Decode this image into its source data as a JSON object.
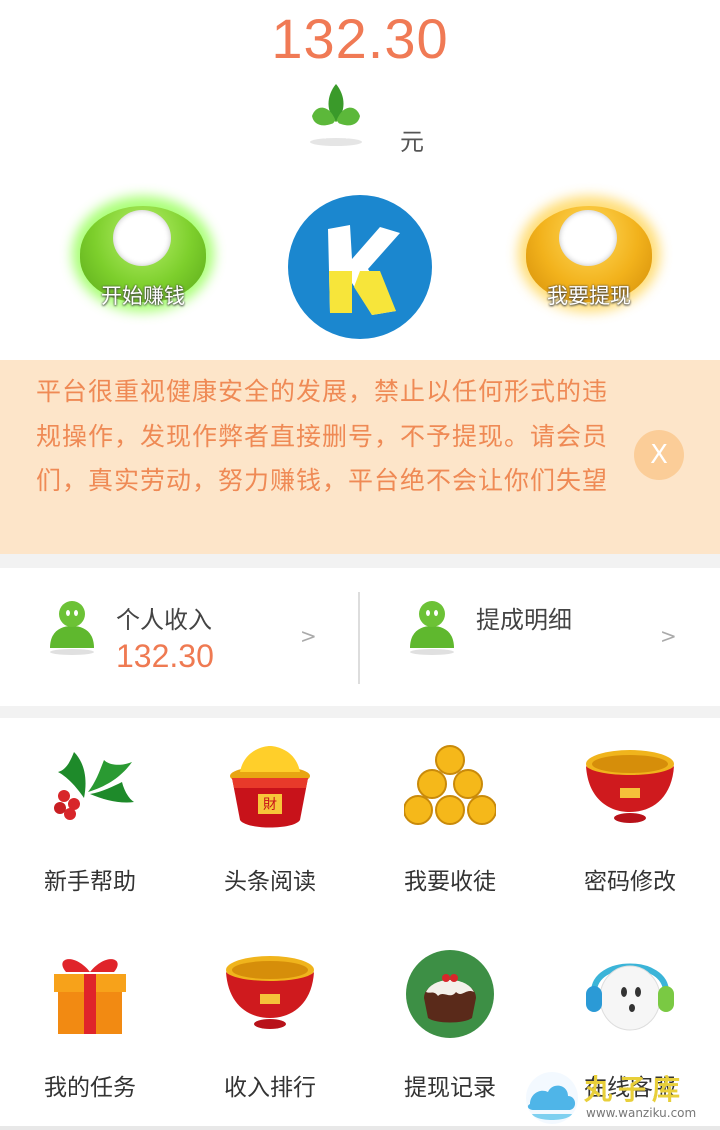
{
  "balance": {
    "amount": "132.30",
    "unit": "元"
  },
  "actions": {
    "earn_label": "开始赚钱",
    "withdraw_label": "我要提现",
    "logo_letter": "K"
  },
  "notice": {
    "text": "平台很重视健康安全的发展，禁止以任何形式的违规操作，发现作弊者直接删号，不予提现。请会员们，真实劳动，努力赚钱，平台绝不会让你们失望",
    "close_label": "X"
  },
  "stats": {
    "income_label": "个人收入",
    "income_value": "132.30",
    "commission_label": "提成明细",
    "chevron": ">"
  },
  "menu": [
    {
      "label": "新手帮助",
      "icon": "holly-icon"
    },
    {
      "label": "头条阅读",
      "icon": "treasure-bowl-icon"
    },
    {
      "label": "我要收徒",
      "icon": "gold-coins-icon"
    },
    {
      "label": "密码修改",
      "icon": "red-bowl-icon"
    },
    {
      "label": "我的任务",
      "icon": "gift-box-icon"
    },
    {
      "label": "收入排行",
      "icon": "red-bowl-icon"
    },
    {
      "label": "提现记录",
      "icon": "pudding-icon"
    },
    {
      "label": "在线客服",
      "icon": "headset-icon"
    }
  ],
  "watermark": {
    "title": "丸子库",
    "url": "www.wanziku.com"
  },
  "colors": {
    "accent": "#f07a55",
    "notice_bg": "#fde5c9",
    "notice_text": "#ef8a55"
  }
}
